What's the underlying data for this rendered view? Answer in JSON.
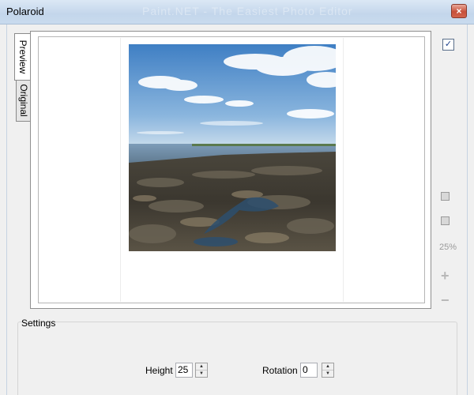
{
  "window": {
    "title": "Polaroid",
    "background_title": "Paint.NET - The Easiest Photo Editor",
    "close_glyph": "×"
  },
  "tabs": {
    "preview": "Preview",
    "original": "Original"
  },
  "side_panel": {
    "checkbox_glyph": "✓",
    "zoom_level": "25%",
    "zoom_in_glyph": "+",
    "zoom_out_glyph": "−"
  },
  "settings": {
    "label": "Settings",
    "height_label": "Height",
    "height_value": "25",
    "rotation_label": "Rotation",
    "rotation_value": "0"
  },
  "colors": {
    "sky_top": "#4a86c8",
    "sky_bottom": "#b8d3ea",
    "sea": "#6b8aa6",
    "rocks": "#3e3a33"
  }
}
